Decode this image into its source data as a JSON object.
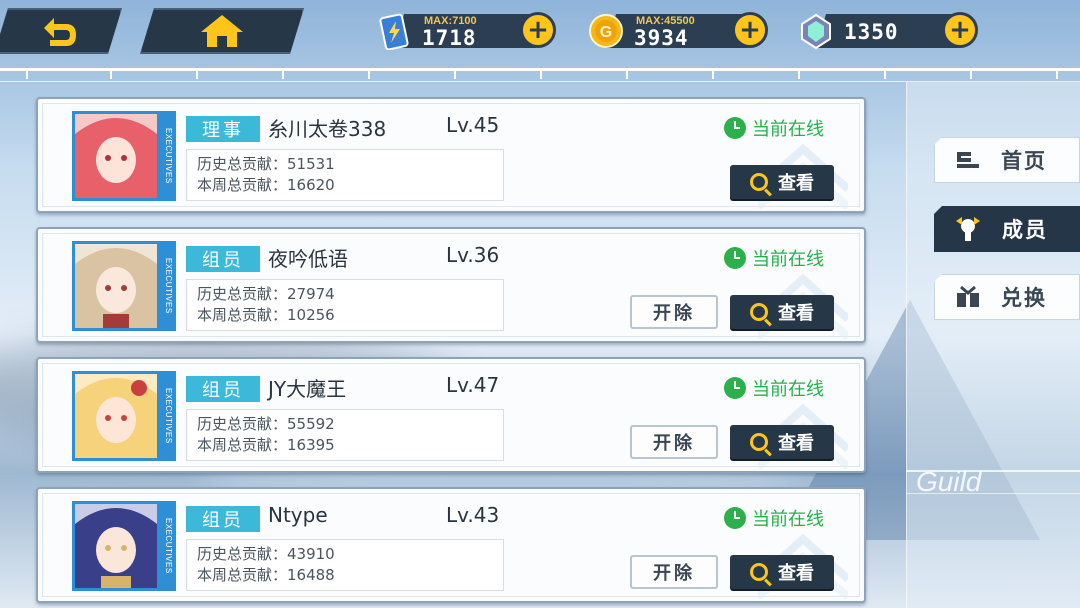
{
  "resources": [
    {
      "name": "energy",
      "icon": "energy-battery-icon",
      "max": "MAX:7100",
      "value": "1718",
      "color": "#3a7fd6"
    },
    {
      "name": "gold",
      "icon": "gold-coin-icon",
      "max": "MAX:45500",
      "value": "3934",
      "color": "#f5b816"
    },
    {
      "name": "gems",
      "icon": "crystal-gem-icon",
      "value": "1350",
      "color": "#7bd0c9"
    }
  ],
  "sidebar": {
    "items": [
      {
        "label": "首页",
        "icon": "flag-icon",
        "active": false
      },
      {
        "label": "成员",
        "icon": "members-icon",
        "active": true
      },
      {
        "label": "兑换",
        "icon": "exchange-icon",
        "active": false
      }
    ],
    "watermark": "Guild"
  },
  "members": [
    {
      "role": "理事",
      "name": "糸川太卷338",
      "level": "Lv.45",
      "history": "历史总贡献：51531",
      "weekly": "本周总贡献：16620",
      "status": "当前在线",
      "view": "查看",
      "kick": null,
      "badge": "EXECUTIVES",
      "palette": [
        "#e8606a",
        "#f7c8c8"
      ]
    },
    {
      "role": "组员",
      "name": "夜吟低语",
      "level": "Lv.36",
      "history": "历史总贡献：27974",
      "weekly": "本周总贡献：10256",
      "status": "当前在线",
      "view": "查看",
      "kick": "开除",
      "badge": "EXECUTIVES",
      "palette": [
        "#d9c3a3",
        "#a33b3b"
      ]
    },
    {
      "role": "组员",
      "name": "JY大魔王",
      "level": "Lv.47",
      "history": "历史总贡献：55592",
      "weekly": "本周总贡献：16395",
      "status": "当前在线",
      "view": "查看",
      "kick": "开除",
      "badge": "EXECUTIVES",
      "palette": [
        "#f6d27a",
        "#c94040"
      ]
    },
    {
      "role": "组员",
      "name": "Ntype",
      "level": "Lv.43",
      "history": "历史总贡献：43910",
      "weekly": "本周总贡献：16488",
      "status": "当前在线",
      "view": "查看",
      "kick": "开除",
      "badge": "EXECUTIVES",
      "palette": [
        "#3a3f8a",
        "#d8b46a"
      ]
    }
  ]
}
